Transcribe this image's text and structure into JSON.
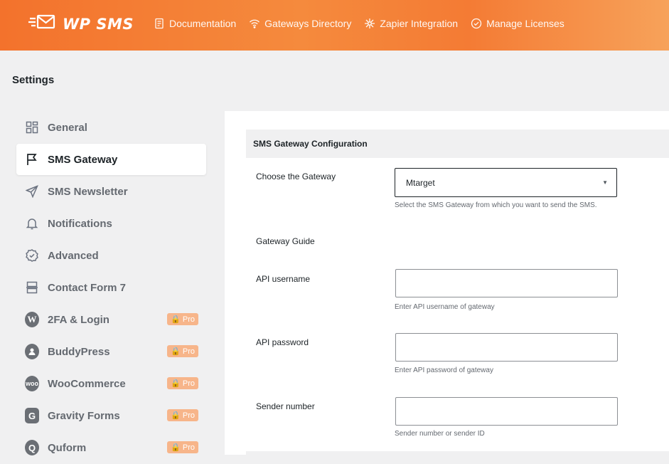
{
  "brand": {
    "name": "WP SMS"
  },
  "topnav": [
    {
      "label": "Documentation",
      "icon": "document-icon"
    },
    {
      "label": "Gateways Directory",
      "icon": "wifi-icon"
    },
    {
      "label": "Zapier Integration",
      "icon": "zapier-icon"
    },
    {
      "label": "Manage Licenses",
      "icon": "check-badge-icon"
    }
  ],
  "page": {
    "title": "Settings"
  },
  "sidebar": {
    "items": [
      {
        "label": "General",
        "icon": "grid-icon"
      },
      {
        "label": "SMS Gateway",
        "icon": "flag-icon",
        "active": true
      },
      {
        "label": "SMS Newsletter",
        "icon": "send-icon"
      },
      {
        "label": "Notifications",
        "icon": "bell-icon"
      },
      {
        "label": "Advanced",
        "icon": "badge-check-icon"
      },
      {
        "label": "Contact Form 7",
        "icon": "form-icon"
      },
      {
        "label": "2FA & Login",
        "icon": "wordpress-icon",
        "badge": "Pro"
      },
      {
        "label": "BuddyPress",
        "icon": "buddypress-icon",
        "badge": "Pro"
      },
      {
        "label": "WooCommerce",
        "icon": "woocommerce-icon",
        "badge": "Pro",
        "icon_text": "woo"
      },
      {
        "label": "Gravity Forms",
        "icon": "gravity-forms-icon",
        "badge": "Pro"
      },
      {
        "label": "Quform",
        "icon": "quform-icon",
        "badge": "Pro"
      }
    ]
  },
  "section": {
    "title": "SMS Gateway Configuration"
  },
  "form": {
    "gateway": {
      "label": "Choose the Gateway",
      "value": "Mtarget",
      "hint": "Select the SMS Gateway from which you want to send the SMS."
    },
    "guide": {
      "label": "Gateway Guide"
    },
    "api_username": {
      "label": "API username",
      "value": "",
      "hint": "Enter API username of gateway"
    },
    "api_password": {
      "label": "API password",
      "value": "",
      "hint": "Enter API password of gateway"
    },
    "sender": {
      "label": "Sender number",
      "value": "",
      "hint": "Sender number or sender ID"
    }
  },
  "colors": {
    "accent": "#f3722c",
    "pro_badge": "#f7b58a"
  }
}
